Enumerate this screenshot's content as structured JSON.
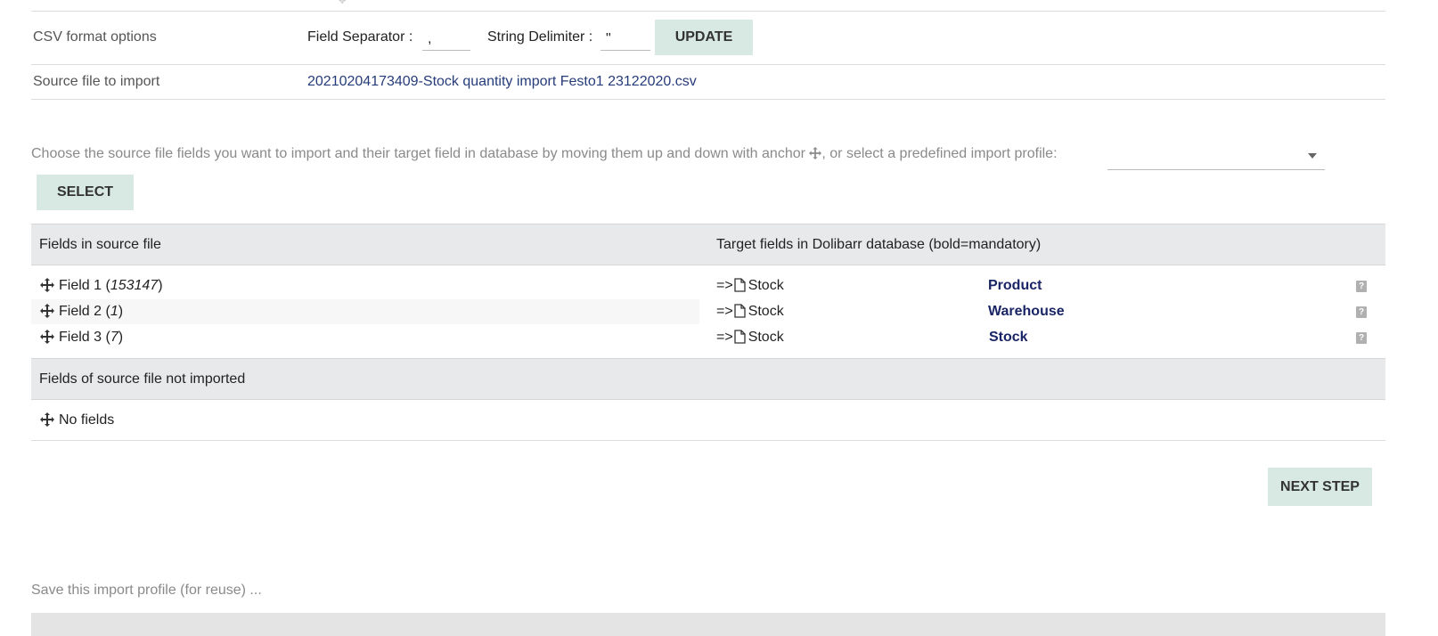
{
  "csv_options": {
    "label": "CSV format options",
    "field_separator_label": "Field Separator :",
    "field_separator_value": ",",
    "string_delimiter_label": "String Delimiter :",
    "string_delimiter_value": "\"",
    "update_button": "UPDATE"
  },
  "source_file": {
    "label": "Source file to import",
    "filename": "20210204173409-Stock quantity import Festo1 23122020.csv"
  },
  "mapping_hint": {
    "text_before": "Choose the source file fields you want to import and their target field in database by moving them up and down with anchor ",
    "text_after": ", or select a predefined import profile:",
    "profile_selected": "",
    "select_button": "SELECT"
  },
  "mapping_table": {
    "source_header": "Fields in source file",
    "target_header": "Target fields in Dolibarr database (bold=mandatory)",
    "rows": [
      {
        "field": "Field 1",
        "sample": "153147",
        "arrow": "=>",
        "table": "Stock",
        "target": "Product",
        "help": "?"
      },
      {
        "field": "Field 2",
        "sample": "1",
        "arrow": "=>",
        "table": "Stock",
        "target": "Warehouse",
        "help": "?"
      },
      {
        "field": "Field 3",
        "sample": "7",
        "arrow": "=>",
        "table": "Stock",
        "target": "Stock",
        "help": "?"
      }
    ],
    "not_imported_header": "Fields of source file not imported",
    "not_imported_value": "No fields"
  },
  "next_button": "NEXT STEP",
  "save_profile_hint": "Save this import profile (for reuse) ...",
  "icons": {
    "move": "arrows-move-icon",
    "file": "file-icon",
    "help": "help-icon",
    "dropdown": "caret-down-icon"
  }
}
